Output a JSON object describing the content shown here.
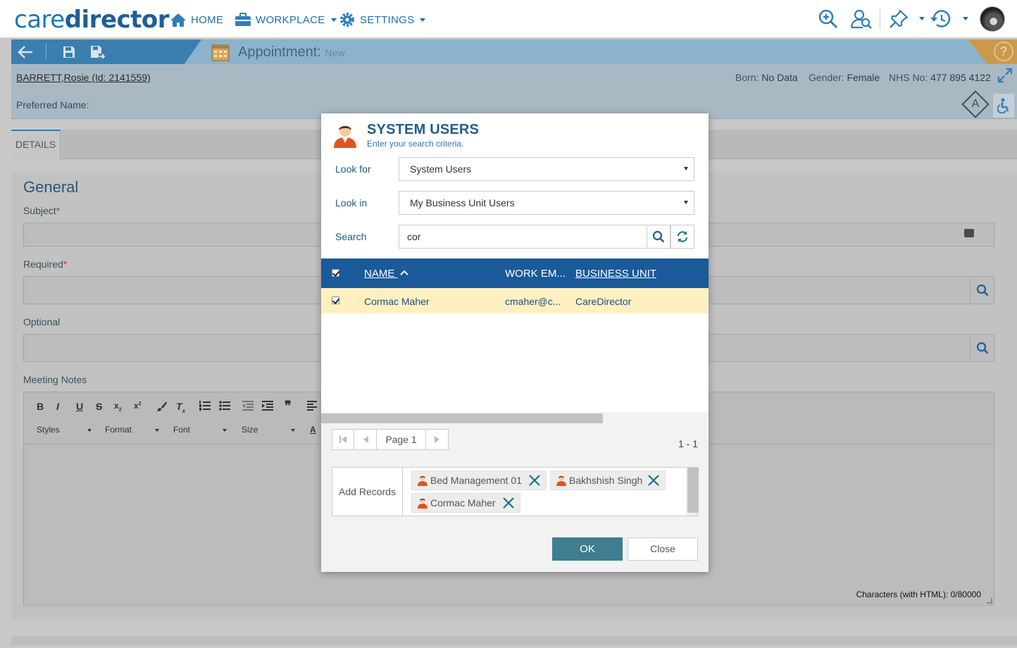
{
  "brand": {
    "logo_part1": "care",
    "logo_part2": "director"
  },
  "nav": {
    "items": [
      {
        "label": "HOME",
        "icon": "home-icon"
      },
      {
        "label": "WORKPLACE",
        "icon": "briefcase-icon"
      },
      {
        "label": "SETTINGS",
        "icon": "gear-icon"
      }
    ],
    "tools": [
      "zoom-in-icon",
      "user-search-icon",
      "pin-icon",
      "history-icon"
    ]
  },
  "record": {
    "title": "Appointment:",
    "status": "New",
    "help_label": "?"
  },
  "patient": {
    "name": "BARRETT,Rosie (Id: 2141559)",
    "born_label": "Born:",
    "born_value": "No Data",
    "gender_label": "Gender:",
    "gender_value": "Female",
    "nhs_label": "NHS No:",
    "nhs_value": "477 895 4122",
    "preferred_label": "Preferred Name:",
    "alert_letter": "A"
  },
  "tabs": [
    {
      "label": "DETAILS"
    }
  ],
  "form": {
    "section_title": "General",
    "subject_label": "Subject",
    "required_label": "Required",
    "optional_label": "Optional",
    "notes_label": "Meeting Notes",
    "required_mark": "*",
    "editor": {
      "buttons": [
        "B",
        "I",
        "U",
        "S"
      ],
      "combos": [
        "Styles",
        "Format",
        "Font",
        "Size"
      ],
      "char_count": "Characters (with HTML): 0/80000"
    }
  },
  "dialog": {
    "title": "SYSTEM USERS",
    "subtitle": "Enter your search criteria.",
    "look_for_label": "Look for",
    "look_for_value": "System Users",
    "look_in_label": "Look in",
    "look_in_value": "My Business Unit Users",
    "search_label": "Search",
    "search_value": "cor",
    "columns": {
      "name": "NAME",
      "work_email": "WORK EM...",
      "business_unit": "BUSINESS UNIT"
    },
    "rows": [
      {
        "name": "Cormac Maher",
        "work_email": "cmaher@c...",
        "business_unit": "CareDirector",
        "checked": true
      }
    ],
    "pager": {
      "page_label": "Page 1",
      "count": "1 - 1"
    },
    "add_records_label": "Add Records",
    "selected": [
      {
        "name": "Bed Management 01"
      },
      {
        "name": "Bakhshish Singh"
      },
      {
        "name": "Cormac Maher"
      }
    ],
    "ok_label": "OK",
    "close_label": "Close"
  },
  "colors": {
    "brand_blue": "#1a75bb",
    "dialog_header": "#1a5a9a",
    "selected_row": "#fff0c2",
    "ok_button": "#3e7e8e"
  }
}
